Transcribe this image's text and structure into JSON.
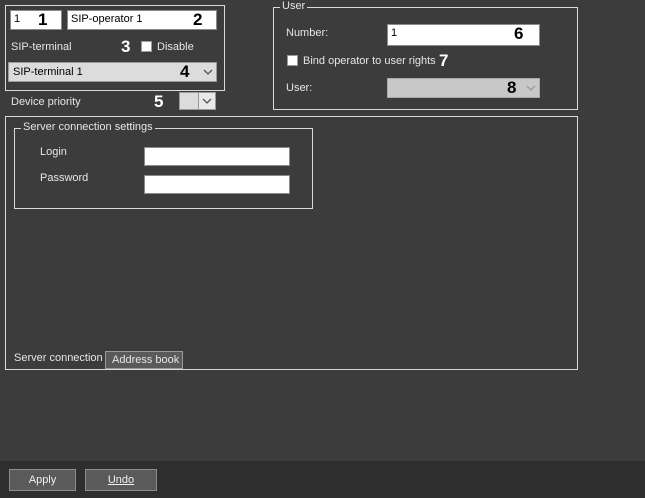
{
  "operator": {
    "id_value": "1",
    "name_value": "SIP-operator 1",
    "sip_terminal_label": "SIP-terminal",
    "disable_label": "Disable",
    "sip_terminal_value": "SIP-terminal 1",
    "device_priority_label": "Device priority",
    "device_priority_value": ""
  },
  "user_group": {
    "title": "User",
    "number_label": "Number:",
    "number_value": "1",
    "bind_label": "Bind operator to user rights",
    "user_label": "User:",
    "user_value": ""
  },
  "server_connection": {
    "title": "Server connection settings",
    "login_label": "Login",
    "login_value": "",
    "password_label": "Password",
    "password_value": ""
  },
  "tabs": [
    {
      "label": "Server connection",
      "active": true
    },
    {
      "label": "Address book",
      "active": false
    }
  ],
  "markers": [
    "1",
    "2",
    "3",
    "4",
    "5",
    "6",
    "7",
    "8"
  ],
  "footer": {
    "apply_label": "Apply",
    "undo_label": "Undo"
  },
  "colors": {
    "background": "#3c3c3c",
    "field": "#ffffff",
    "dropdown": "#dcdcdc",
    "border": "#d9d9d9"
  }
}
